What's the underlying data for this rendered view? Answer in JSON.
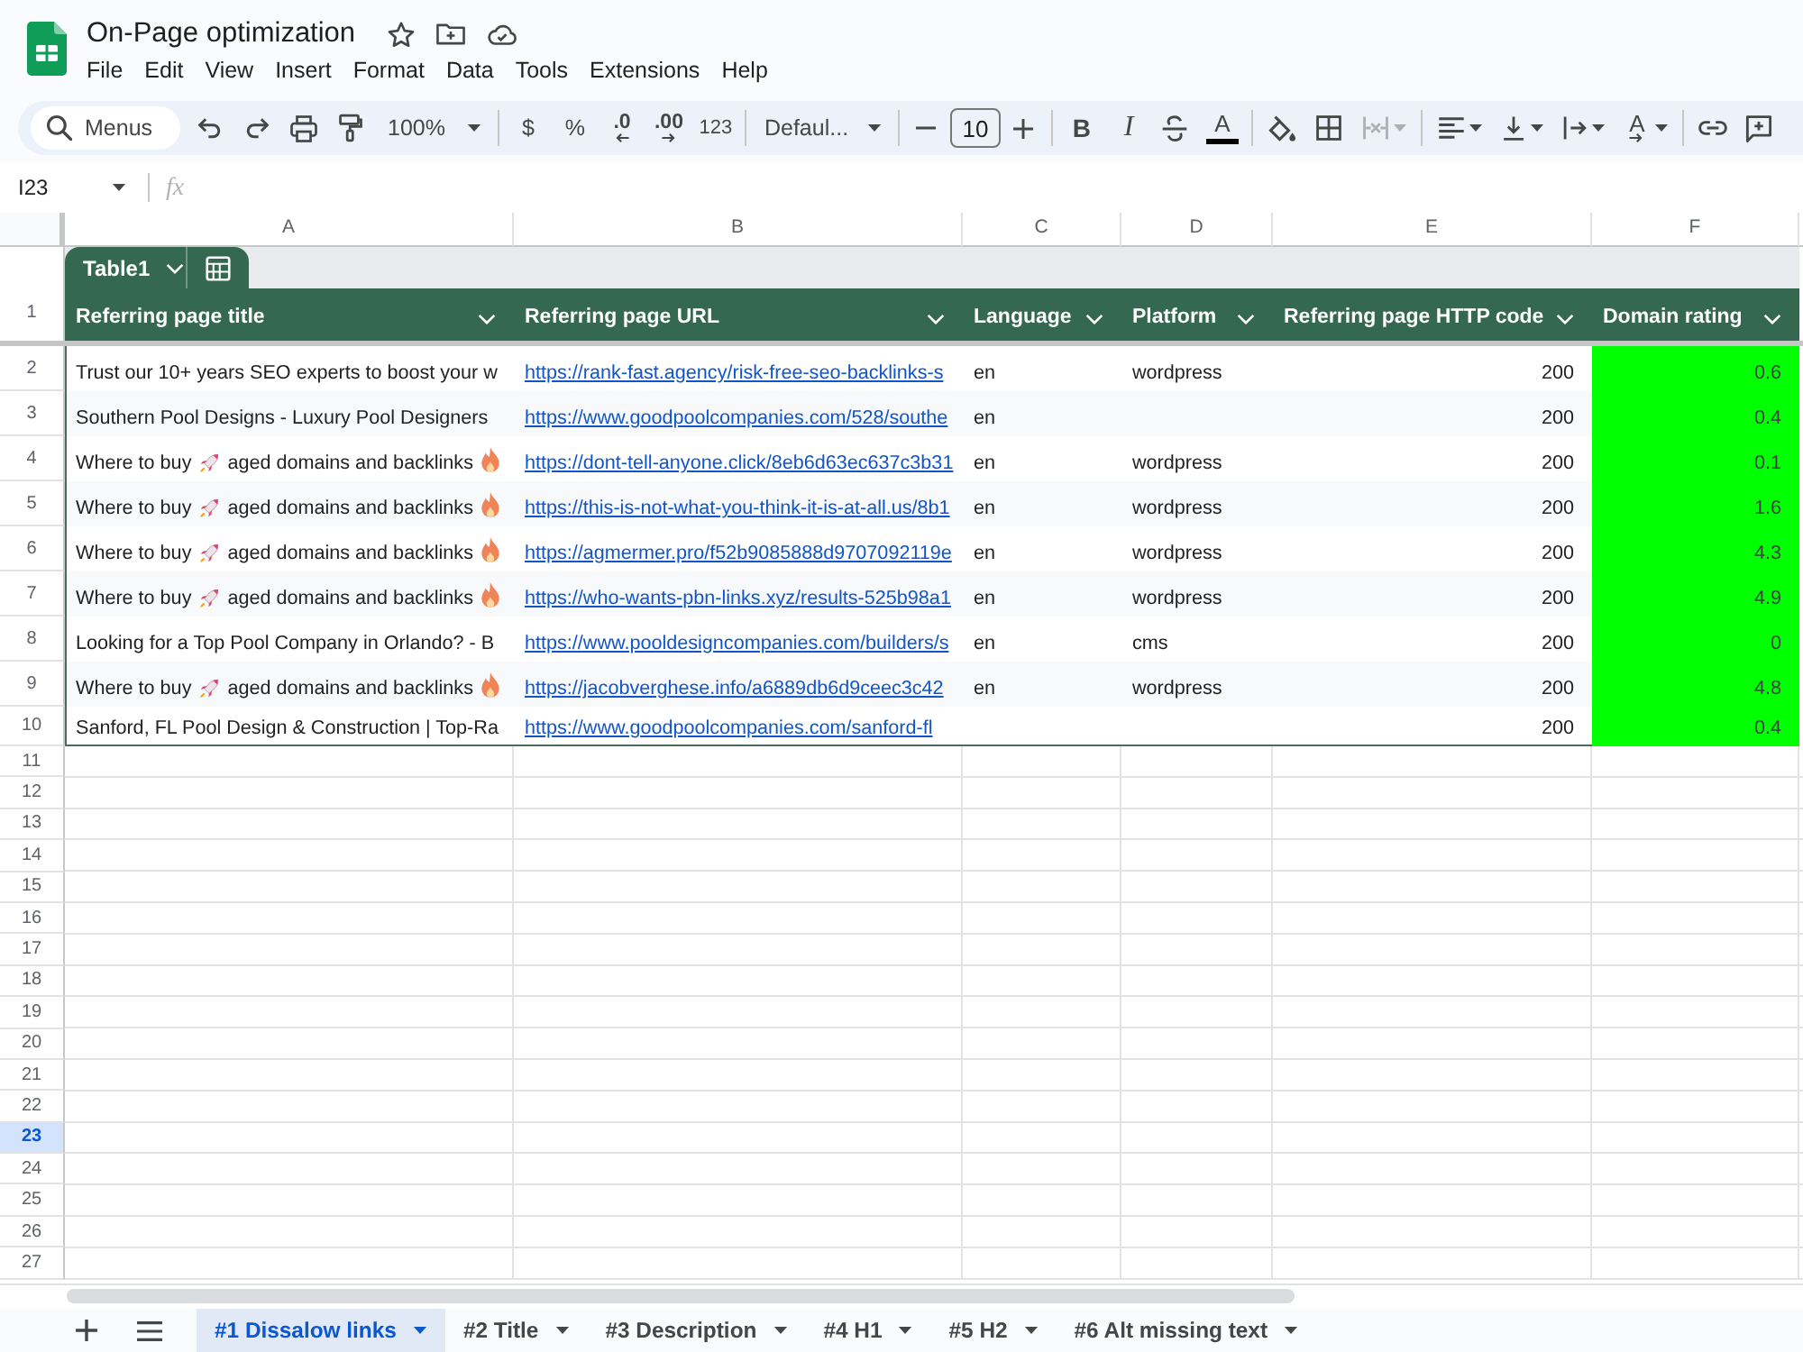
{
  "document": {
    "title": "On-Page optimization",
    "menus": [
      "File",
      "Edit",
      "View",
      "Insert",
      "Format",
      "Data",
      "Tools",
      "Extensions",
      "Help"
    ]
  },
  "toolbar": {
    "search": {
      "placeholder": "Menus"
    },
    "zoom": "100%",
    "currency": "$",
    "percent": "%",
    "decrease_decimals": ".0",
    "increase_decimals": ".00",
    "more_formats": "123",
    "font": "Defaul...",
    "font_size": "10",
    "bold": "B",
    "italic": "I",
    "text_color": "A",
    "merge_cells": {
      "disabled": true
    },
    "text_rotation": "A"
  },
  "formula_bar": {
    "name_box": "I23",
    "function_label": "fx"
  },
  "column_letters": [
    "A",
    "B",
    "C",
    "D",
    "E",
    "F"
  ],
  "table": {
    "name": "Table1",
    "columns": [
      {
        "title": "Referring page title",
        "highlighted": false
      },
      {
        "title": "Referring page URL",
        "highlighted": false
      },
      {
        "title": "Language",
        "highlighted": false
      },
      {
        "title": "Platform",
        "highlighted": false
      },
      {
        "title": "Referring page HTTP code",
        "highlighted": false
      },
      {
        "title": "Domain rating",
        "highlighted": true
      }
    ],
    "rows": [
      {
        "title": {
          "kind": "plain",
          "text": "Trust our 10+ years SEO experts to boost your w"
        },
        "url": "https://rank-fast.agency/risk-free-seo-backlinks-s",
        "language": "en",
        "platform": "wordpress",
        "http_code": "200",
        "domain_rating": "0.6"
      },
      {
        "title": {
          "kind": "plain",
          "text": "Southern Pool Designs - Luxury Pool Designers"
        },
        "url": "https://www.goodpoolcompanies.com/528/southe",
        "language": "en",
        "http_code": "200",
        "domain_rating": "0.4"
      },
      {
        "title": {
          "kind": "emoji",
          "parts": [
            "Where to buy",
            "aged domains and backlinks"
          ]
        },
        "url": "https://dont-tell-anyone.click/8eb6d63ec637c3b31",
        "language": "en",
        "platform": "wordpress",
        "http_code": "200",
        "domain_rating": "0.1"
      },
      {
        "title": {
          "kind": "emoji",
          "parts": [
            "Where to buy",
            "aged domains and backlinks"
          ]
        },
        "url": "https://this-is-not-what-you-think-it-is-at-all.us/8b1",
        "language": "en",
        "platform": "wordpress",
        "http_code": "200",
        "domain_rating": "1.6"
      },
      {
        "title": {
          "kind": "emoji",
          "parts": [
            "Where to buy",
            "aged domains and backlinks"
          ]
        },
        "url": "https://agmermer.pro/f52b9085888d9707092119e",
        "language": "en",
        "platform": "wordpress",
        "http_code": "200",
        "domain_rating": "4.3"
      },
      {
        "title": {
          "kind": "emoji",
          "parts": [
            "Where to buy",
            "aged domains and backlinks"
          ]
        },
        "url": "https://who-wants-pbn-links.xyz/results-525b98a1",
        "language": "en",
        "platform": "wordpress",
        "http_code": "200",
        "domain_rating": "4.9"
      },
      {
        "title": {
          "kind": "plain",
          "text": "Looking for a Top Pool Company in Orlando? - B"
        },
        "url": "https://www.pooldesigncompanies.com/builders/s",
        "language": "en",
        "platform": "cms",
        "http_code": "200",
        "domain_rating": "0"
      },
      {
        "title": {
          "kind": "emoji",
          "parts": [
            "Where to buy",
            "aged domains and backlinks"
          ]
        },
        "url": "https://jacobverghese.info/a6889db6d9ceec3c42",
        "language": "en",
        "platform": "wordpress",
        "http_code": "200",
        "domain_rating": "4.8"
      },
      {
        "title": {
          "kind": "plain",
          "text": "Sanford, FL Pool Design & Construction | Top-Ra"
        },
        "url": "https://www.goodpoolcompanies.com/sanford-fl",
        "http_code": "200",
        "domain_rating": "0.4"
      }
    ]
  },
  "row_headers": [
    {
      "number": "1",
      "selected": false
    },
    {
      "number": "2",
      "selected": false
    },
    {
      "number": "3",
      "selected": false
    },
    {
      "number": "4",
      "selected": false
    },
    {
      "number": "5",
      "selected": false
    },
    {
      "number": "6",
      "selected": false
    },
    {
      "number": "7",
      "selected": false
    },
    {
      "number": "8",
      "selected": false
    },
    {
      "number": "9",
      "selected": false
    },
    {
      "number": "10",
      "selected": false
    },
    {
      "number": "11",
      "selected": false
    },
    {
      "number": "12",
      "selected": false
    },
    {
      "number": "13",
      "selected": false
    },
    {
      "number": "14",
      "selected": false
    },
    {
      "number": "15",
      "selected": false
    },
    {
      "number": "16",
      "selected": false
    },
    {
      "number": "17",
      "selected": false
    },
    {
      "number": "18",
      "selected": false
    },
    {
      "number": "19",
      "selected": false
    },
    {
      "number": "20",
      "selected": false
    },
    {
      "number": "21",
      "selected": false
    },
    {
      "number": "22",
      "selected": false
    },
    {
      "number": "23",
      "selected": true
    },
    {
      "number": "24",
      "selected": false
    },
    {
      "number": "25",
      "selected": false
    },
    {
      "number": "26",
      "selected": false
    },
    {
      "number": "27",
      "selected": false
    }
  ],
  "sheet_tabs": [
    {
      "label": "#1 Dissalow links",
      "selected": true
    },
    {
      "label": "#2 Title",
      "selected": false
    },
    {
      "label": "#3 Description",
      "selected": false
    },
    {
      "label": "#4 H1",
      "selected": false
    },
    {
      "label": "#5 H2",
      "selected": false
    },
    {
      "label": "#6 Alt missing text",
      "selected": false
    }
  ]
}
